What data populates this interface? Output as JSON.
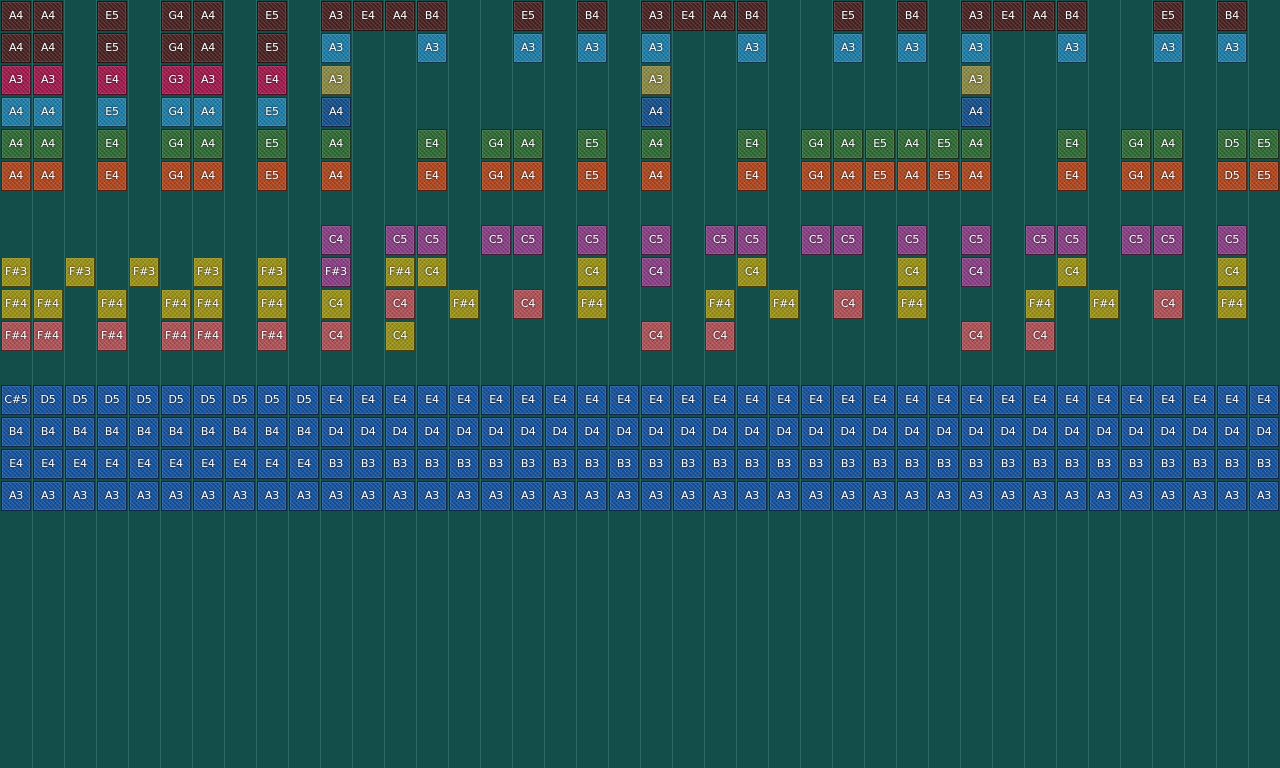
{
  "colors": {
    "dark_brown": "#4a2222",
    "crimson": "#a3194e",
    "cyan": "#1e7ea8",
    "navy": "#14508e",
    "green": "#2f6b35",
    "orange": "#b2461e",
    "purple": "#8a3f86",
    "yellow": "#9c9317",
    "pink": "#b05257",
    "olive": "#8d8b45",
    "blue": "#1553a0"
  },
  "rows": [
    {
      "name": "row-0",
      "color": "dark_brown",
      "notes": [
        [
          0,
          "A4"
        ],
        [
          1,
          "A4"
        ],
        [
          3,
          "E5"
        ],
        [
          5,
          "G4"
        ],
        [
          6,
          "A4"
        ],
        [
          8,
          "E5"
        ],
        [
          10,
          "A3"
        ],
        [
          11,
          "E4"
        ],
        [
          12,
          "A4"
        ],
        [
          13,
          "B4"
        ],
        [
          16,
          "E5"
        ],
        [
          18,
          "B4"
        ],
        [
          20,
          "A3"
        ],
        [
          21,
          "E4"
        ],
        [
          22,
          "A4"
        ],
        [
          23,
          "B4"
        ],
        [
          26,
          "E5"
        ],
        [
          28,
          "B4"
        ],
        [
          30,
          "A3"
        ],
        [
          31,
          "E4"
        ],
        [
          32,
          "A4"
        ],
        [
          33,
          "B4"
        ],
        [
          36,
          "E5"
        ],
        [
          38,
          "B4"
        ]
      ]
    },
    {
      "name": "row-1",
      "notes": [
        [
          0,
          "A4",
          "dark_brown"
        ],
        [
          1,
          "A4",
          "dark_brown"
        ],
        [
          3,
          "E5",
          "dark_brown"
        ],
        [
          5,
          "G4",
          "dark_brown"
        ],
        [
          6,
          "A4",
          "dark_brown"
        ],
        [
          8,
          "E5",
          "dark_brown"
        ],
        [
          10,
          "A3",
          "cyan"
        ],
        [
          13,
          "A3",
          "cyan"
        ],
        [
          16,
          "A3",
          "cyan"
        ],
        [
          18,
          "A3",
          "cyan"
        ],
        [
          20,
          "A3",
          "cyan"
        ],
        [
          23,
          "A3",
          "cyan"
        ],
        [
          26,
          "A3",
          "cyan"
        ],
        [
          28,
          "A3",
          "cyan"
        ],
        [
          30,
          "A3",
          "cyan"
        ],
        [
          33,
          "A3",
          "cyan"
        ],
        [
          36,
          "A3",
          "cyan"
        ],
        [
          38,
          "A3",
          "cyan"
        ]
      ]
    },
    {
      "name": "row-2",
      "notes": [
        [
          0,
          "A3",
          "crimson"
        ],
        [
          1,
          "A3",
          "crimson"
        ],
        [
          3,
          "E4",
          "crimson"
        ],
        [
          5,
          "G3",
          "crimson"
        ],
        [
          6,
          "A3",
          "crimson"
        ],
        [
          8,
          "E4",
          "crimson"
        ],
        [
          10,
          "A3",
          "olive"
        ],
        [
          20,
          "A3",
          "olive"
        ],
        [
          30,
          "A3",
          "olive"
        ]
      ]
    },
    {
      "name": "row-3",
      "notes": [
        [
          0,
          "A4",
          "cyan"
        ],
        [
          1,
          "A4",
          "cyan"
        ],
        [
          3,
          "E5",
          "cyan"
        ],
        [
          5,
          "G4",
          "cyan"
        ],
        [
          6,
          "A4",
          "cyan"
        ],
        [
          8,
          "E5",
          "cyan"
        ],
        [
          10,
          "A4",
          "navy"
        ],
        [
          20,
          "A4",
          "navy"
        ],
        [
          30,
          "A4",
          "navy"
        ]
      ]
    },
    {
      "name": "row-4",
      "color": "green",
      "notes": [
        [
          0,
          "A4"
        ],
        [
          1,
          "A4"
        ],
        [
          3,
          "E4"
        ],
        [
          5,
          "G4"
        ],
        [
          6,
          "A4"
        ],
        [
          8,
          "E5"
        ],
        [
          10,
          "A4"
        ],
        [
          13,
          "E4"
        ],
        [
          15,
          "G4"
        ],
        [
          16,
          "A4"
        ],
        [
          18,
          "E5"
        ],
        [
          20,
          "A4"
        ],
        [
          23,
          "E4"
        ],
        [
          25,
          "G4"
        ],
        [
          26,
          "A4"
        ],
        [
          27,
          "E5"
        ],
        [
          28,
          "A4"
        ],
        [
          29,
          "E5"
        ],
        [
          30,
          "A4"
        ],
        [
          33,
          "E4"
        ],
        [
          35,
          "G4"
        ],
        [
          36,
          "A4"
        ],
        [
          38,
          "D5"
        ],
        [
          39,
          "E5"
        ]
      ]
    },
    {
      "name": "row-5",
      "color": "orange",
      "notes": [
        [
          0,
          "A4"
        ],
        [
          1,
          "A4"
        ],
        [
          3,
          "E4"
        ],
        [
          5,
          "G4"
        ],
        [
          6,
          "A4"
        ],
        [
          8,
          "E5"
        ],
        [
          10,
          "A4"
        ],
        [
          13,
          "E4"
        ],
        [
          15,
          "G4"
        ],
        [
          16,
          "A4"
        ],
        [
          18,
          "E5"
        ],
        [
          20,
          "A4"
        ],
        [
          23,
          "E4"
        ],
        [
          25,
          "G4"
        ],
        [
          26,
          "A4"
        ],
        [
          27,
          "E5"
        ],
        [
          28,
          "A4"
        ],
        [
          29,
          "E5"
        ],
        [
          30,
          "A4"
        ],
        [
          33,
          "E4"
        ],
        [
          35,
          "G4"
        ],
        [
          36,
          "A4"
        ],
        [
          38,
          "D5"
        ],
        [
          39,
          "E5"
        ]
      ]
    },
    {
      "name": "row-7",
      "color": "purple",
      "notes": [
        [
          10,
          "C4"
        ],
        [
          12,
          "C5"
        ],
        [
          13,
          "C5"
        ],
        [
          15,
          "C5"
        ],
        [
          16,
          "C5"
        ],
        [
          18,
          "C5"
        ],
        [
          20,
          "C5"
        ],
        [
          22,
          "C5"
        ],
        [
          23,
          "C5"
        ],
        [
          25,
          "C5"
        ],
        [
          26,
          "C5"
        ],
        [
          28,
          "C5"
        ],
        [
          30,
          "C5"
        ],
        [
          32,
          "C5"
        ],
        [
          33,
          "C5"
        ],
        [
          35,
          "C5"
        ],
        [
          36,
          "C5"
        ],
        [
          38,
          "C5"
        ]
      ]
    },
    {
      "name": "row-8",
      "notes": [
        [
          0,
          "F#3",
          "yellow"
        ],
        [
          2,
          "F#3",
          "yellow"
        ],
        [
          4,
          "F#3",
          "yellow"
        ],
        [
          6,
          "F#3",
          "yellow"
        ],
        [
          8,
          "F#3",
          "yellow"
        ],
        [
          10,
          "F#3",
          "purple"
        ],
        [
          12,
          "F#4",
          "yellow"
        ],
        [
          13,
          "C4",
          "yellow"
        ],
        [
          18,
          "C4",
          "yellow"
        ],
        [
          20,
          "C4",
          "purple"
        ],
        [
          23,
          "C4",
          "yellow"
        ],
        [
          28,
          "C4",
          "yellow"
        ],
        [
          30,
          "C4",
          "purple"
        ],
        [
          33,
          "C4",
          "yellow"
        ],
        [
          38,
          "C4",
          "yellow"
        ]
      ]
    },
    {
      "name": "row-9",
      "notes": [
        [
          0,
          "F#4",
          "yellow"
        ],
        [
          1,
          "F#4",
          "yellow"
        ],
        [
          3,
          "F#4",
          "yellow"
        ],
        [
          5,
          "F#4",
          "yellow"
        ],
        [
          6,
          "F#4",
          "yellow"
        ],
        [
          8,
          "F#4",
          "yellow"
        ],
        [
          10,
          "C4",
          "yellow"
        ],
        [
          12,
          "C4",
          "pink"
        ],
        [
          14,
          "F#4",
          "yellow"
        ],
        [
          16,
          "C4",
          "pink"
        ],
        [
          18,
          "F#4",
          "yellow"
        ],
        [
          22,
          "F#4",
          "yellow"
        ],
        [
          24,
          "F#4",
          "yellow"
        ],
        [
          26,
          "C4",
          "pink"
        ],
        [
          28,
          "F#4",
          "yellow"
        ],
        [
          32,
          "F#4",
          "yellow"
        ],
        [
          34,
          "F#4",
          "yellow"
        ],
        [
          36,
          "C4",
          "pink"
        ],
        [
          38,
          "F#4",
          "yellow"
        ]
      ]
    },
    {
      "name": "row-10",
      "notes": [
        [
          0,
          "F#4",
          "pink"
        ],
        [
          1,
          "F#4",
          "pink"
        ],
        [
          3,
          "F#4",
          "pink"
        ],
        [
          5,
          "F#4",
          "pink"
        ],
        [
          6,
          "F#4",
          "pink"
        ],
        [
          8,
          "F#4",
          "pink"
        ],
        [
          10,
          "C4",
          "pink"
        ],
        [
          12,
          "C4",
          "yellow"
        ],
        [
          20,
          "C4",
          "pink"
        ],
        [
          22,
          "C4",
          "pink"
        ],
        [
          30,
          "C4",
          "pink"
        ],
        [
          32,
          "C4",
          "pink"
        ]
      ]
    },
    {
      "name": "row-12",
      "color": "blue",
      "labels": [
        "C#5",
        "D5",
        "D5",
        "D5",
        "D5",
        "D5",
        "D5",
        "D5",
        "D5",
        "D5",
        "E4",
        "E4",
        "E4",
        "E4",
        "E4",
        "E4",
        "E4",
        "E4",
        "E4",
        "E4",
        "E4",
        "E4",
        "E4",
        "E4",
        "E4",
        "E4",
        "E4",
        "E4",
        "E4",
        "E4",
        "E4",
        "E4",
        "E4",
        "E4",
        "E4",
        "E4",
        "E4",
        "E4",
        "E4",
        "E4"
      ]
    },
    {
      "name": "row-13",
      "color": "blue",
      "labels": [
        "B4",
        "B4",
        "B4",
        "B4",
        "B4",
        "B4",
        "B4",
        "B4",
        "B4",
        "B4",
        "D4",
        "D4",
        "D4",
        "D4",
        "D4",
        "D4",
        "D4",
        "D4",
        "D4",
        "D4",
        "D4",
        "D4",
        "D4",
        "D4",
        "D4",
        "D4",
        "D4",
        "D4",
        "D4",
        "D4",
        "D4",
        "D4",
        "D4",
        "D4",
        "D4",
        "D4",
        "D4",
        "D4",
        "D4",
        "D4"
      ]
    },
    {
      "name": "row-14",
      "color": "blue",
      "labels": [
        "E4",
        "E4",
        "E4",
        "E4",
        "E4",
        "E4",
        "E4",
        "E4",
        "E4",
        "E4",
        "B3",
        "B3",
        "B3",
        "B3",
        "B3",
        "B3",
        "B3",
        "B3",
        "B3",
        "B3",
        "B3",
        "B3",
        "B3",
        "B3",
        "B3",
        "B3",
        "B3",
        "B3",
        "B3",
        "B3",
        "B3",
        "B3",
        "B3",
        "B3",
        "B3",
        "B3",
        "B3",
        "B3",
        "B3",
        "B3"
      ]
    },
    {
      "name": "row-15",
      "color": "blue",
      "labels": [
        "A3",
        "A3",
        "A3",
        "A3",
        "A3",
        "A3",
        "A3",
        "A3",
        "A3",
        "A3",
        "A3",
        "A3",
        "A3",
        "A3",
        "A3",
        "A3",
        "A3",
        "A3",
        "A3",
        "A3",
        "A3",
        "A3",
        "A3",
        "A3",
        "A3",
        "A3",
        "A3",
        "A3",
        "A3",
        "A3",
        "A3",
        "A3",
        "A3",
        "A3",
        "A3",
        "A3",
        "A3",
        "A3",
        "A3",
        "A3"
      ]
    }
  ]
}
